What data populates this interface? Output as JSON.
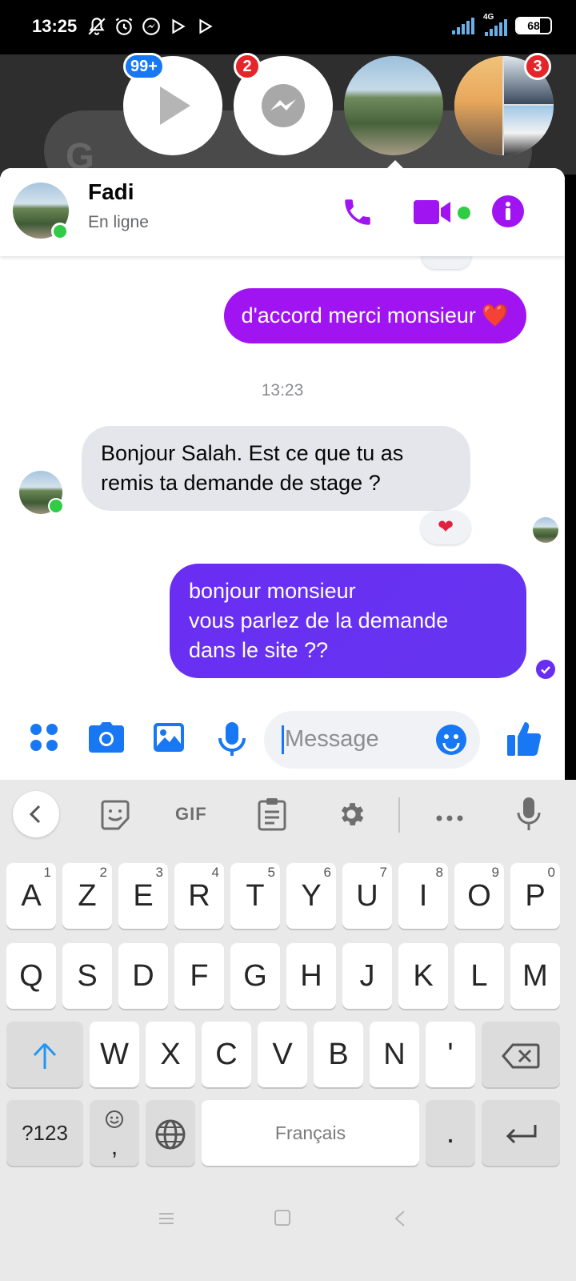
{
  "status_bar": {
    "time": "13:25",
    "network": "4G",
    "battery": "68",
    "battery_level": 0.68
  },
  "chat_heads": [
    {
      "name": "play-app-head",
      "badge": "99+"
    },
    {
      "name": "messenger-head",
      "badge": "2"
    },
    {
      "name": "fadi-head",
      "badge": ""
    },
    {
      "name": "group-head",
      "badge": "3"
    }
  ],
  "contact": {
    "name": "Fadi",
    "status": "En ligne"
  },
  "messages": {
    "out1": "d'accord merci monsieur ❤️",
    "timestamp": "13:23",
    "in1": "Bonjour Salah. Est ce que tu as\nremis ta demande de stage ?",
    "reaction": "❤",
    "out2": "bonjour monsieur\nvous parlez de la demande\ndans le site ??"
  },
  "composer": {
    "placeholder": "Message"
  },
  "keyboard": {
    "toolbar": {
      "gif": "GIF"
    },
    "row1": [
      {
        "k": "A",
        "h": "1"
      },
      {
        "k": "Z",
        "h": "2"
      },
      {
        "k": "E",
        "h": "3"
      },
      {
        "k": "R",
        "h": "4"
      },
      {
        "k": "T",
        "h": "5"
      },
      {
        "k": "Y",
        "h": "6"
      },
      {
        "k": "U",
        "h": "7"
      },
      {
        "k": "I",
        "h": "8"
      },
      {
        "k": "O",
        "h": "9"
      },
      {
        "k": "P",
        "h": "0"
      }
    ],
    "row2": [
      "Q",
      "S",
      "D",
      "F",
      "G",
      "H",
      "J",
      "K",
      "L",
      "M"
    ],
    "row3": [
      "W",
      "X",
      "C",
      "V",
      "B",
      "N",
      "'"
    ],
    "symbols": "?123",
    "comma": ",",
    "space": "Français",
    "period": "."
  }
}
